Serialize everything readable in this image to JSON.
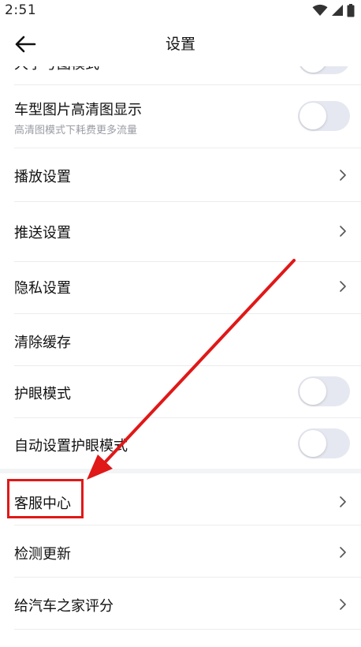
{
  "status_bar": {
    "time": "2:51"
  },
  "header": {
    "title": "设置"
  },
  "partial_row": {
    "label": "大字号图模式"
  },
  "settings": [
    {
      "label": "车型图片高清图显示",
      "sub": "高清图模式下耗费更多流量",
      "control": "toggle",
      "on": false
    },
    {
      "label": "播放设置",
      "control": "chevron"
    },
    {
      "label": "推送设置",
      "control": "chevron"
    },
    {
      "label": "隐私设置",
      "control": "chevron"
    },
    {
      "label": "清除缓存",
      "control": "none"
    },
    {
      "label": "护眼模式",
      "control": "toggle",
      "on": false
    },
    {
      "label": "自动设置护眼模式",
      "control": "toggle",
      "on": false
    },
    {
      "label": "客服中心",
      "control": "chevron",
      "highlighted": true
    },
    {
      "label": "检测更新",
      "control": "chevron"
    },
    {
      "label": "给汽车之家评分",
      "control": "chevron"
    }
  ],
  "annotation": {
    "color": "#e01818",
    "target": "客服中心"
  }
}
